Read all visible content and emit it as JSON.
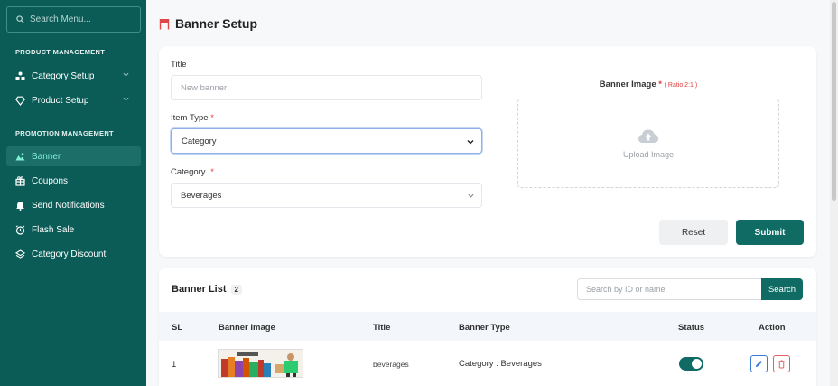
{
  "sidebar": {
    "search_placeholder": "Search Menu...",
    "sections": [
      {
        "title": "PRODUCT MANAGEMENT"
      },
      {
        "title": "PROMOTION MANAGEMENT"
      }
    ],
    "items": [
      {
        "label": "Category Setup",
        "icon": "category-icon"
      },
      {
        "label": "Product Setup",
        "icon": "diamond-icon"
      },
      {
        "label": "Banner",
        "icon": "image-icon",
        "active": true
      },
      {
        "label": "Coupons",
        "icon": "gift-icon"
      },
      {
        "label": "Send Notifications",
        "icon": "bell-icon"
      },
      {
        "label": "Flash Sale",
        "icon": "clock-icon"
      },
      {
        "label": "Category Discount",
        "icon": "layers-icon"
      }
    ]
  },
  "page": {
    "title": "Banner Setup",
    "title_icon": "banner-flag-icon"
  },
  "form": {
    "title_label": "Title",
    "title_placeholder": "New banner",
    "item_type_label": "Item Type",
    "item_type_required": "*",
    "item_type_value": "Category",
    "category_label": "Category",
    "category_required": "*",
    "category_value": "Beverages",
    "banner_image_label": "Banner Image",
    "banner_image_required": "*",
    "banner_image_ratio": "( Ratio 2:1 )",
    "upload_text": "Upload Image",
    "reset_label": "Reset",
    "submit_label": "Submit"
  },
  "list": {
    "title": "Banner List",
    "count": "2",
    "search_placeholder": "Search by ID or name",
    "search_button": "Search",
    "columns": [
      "SL",
      "Banner Image",
      "Title",
      "Banner Type",
      "Status",
      "Action"
    ],
    "rows": [
      {
        "sl": "1",
        "title": "beverages",
        "type": "Category : Beverages",
        "status_on": true
      }
    ]
  },
  "colors": {
    "sidebar_bg": "#0b5c57",
    "accent": "#0f6b64",
    "active_text": "#7ff0d5",
    "required": "#e03b3b"
  }
}
